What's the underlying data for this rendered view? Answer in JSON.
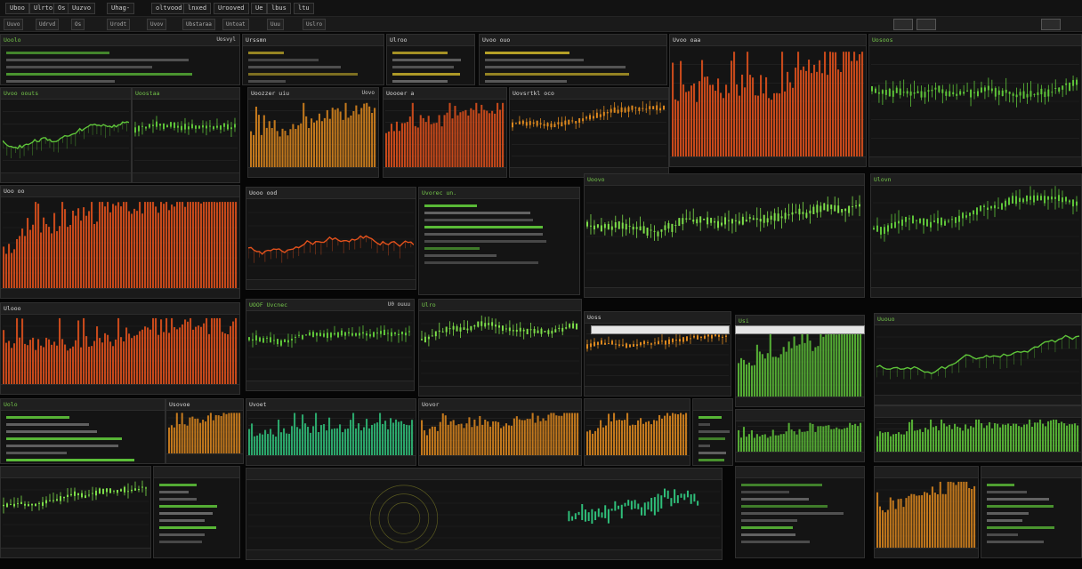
{
  "menubar": {
    "items": [
      "Uboo",
      "Ulrto",
      "Os",
      "Uuzvo",
      "Uhag-",
      "oltvood",
      "lnxed",
      "Urooved",
      "Ue",
      "lbus",
      "ltu"
    ]
  },
  "toolbar": {
    "items": [
      "Uuvo",
      "Udrvd",
      "Os",
      "Urodt",
      "Uvov",
      "Ubstaraa",
      "Untoat",
      "Uuu",
      "Uslro"
    ]
  },
  "panels": {
    "p01": {
      "title": "Uoolo ",
      "tag": "Uosvyl"
    },
    "p02": {
      "title": "Urssmn"
    },
    "p03": {
      "title": "Ulroo "
    },
    "p04": {
      "title": "Uvoo ouo"
    },
    "p05": {
      "title": "Uvoo oaa"
    },
    "p06": {
      "title": "Uosoos"
    },
    "p07": {
      "title": "Uvoo oouts"
    },
    "p08": {
      "title": "Uoostaa"
    },
    "p09": {
      "title": "Uoozzer  uiu",
      "tag": "Uovo"
    },
    "p10": {
      "title": "Uoooer a"
    },
    "p11": {
      "title": "Uovsrtkl  oco"
    },
    "p12": {
      "title": "Uoo oo"
    },
    "p13": {
      "title": "Uooo   ood"
    },
    "p14": {
      "title": "Uvorec un."
    },
    "p15": {
      "title": "Uoovo"
    },
    "p16": {
      "title": "Ulovn"
    },
    "p17": {
      "title": "Ulooo"
    },
    "p18": {
      "title": "UOOF Uvcnec",
      "tag": "U0 ouuu"
    },
    "p19": {
      "title": "Ulro"
    },
    "p20": {
      "title": "Uoss"
    },
    "p21": {
      "title": "Usi"
    },
    "p22": {
      "title": "Uuouo"
    },
    "p23": {
      "title": "Uolo"
    },
    "p24": {
      "title": "Usovoe"
    },
    "p25": {
      "title": "Uvoet"
    },
    "p26": {
      "title": "Uovor"
    }
  },
  "colors": {
    "green": "#5fc63a",
    "green_bright": "#7ee04a",
    "orange": "#e08a1e",
    "red_orange": "#e5521c",
    "teal": "#2fbf7a",
    "yellow": "#c9b12a",
    "background": "#141414"
  },
  "icons": [
    "dropdown-icon",
    "settings-icon",
    "close-icon"
  ]
}
